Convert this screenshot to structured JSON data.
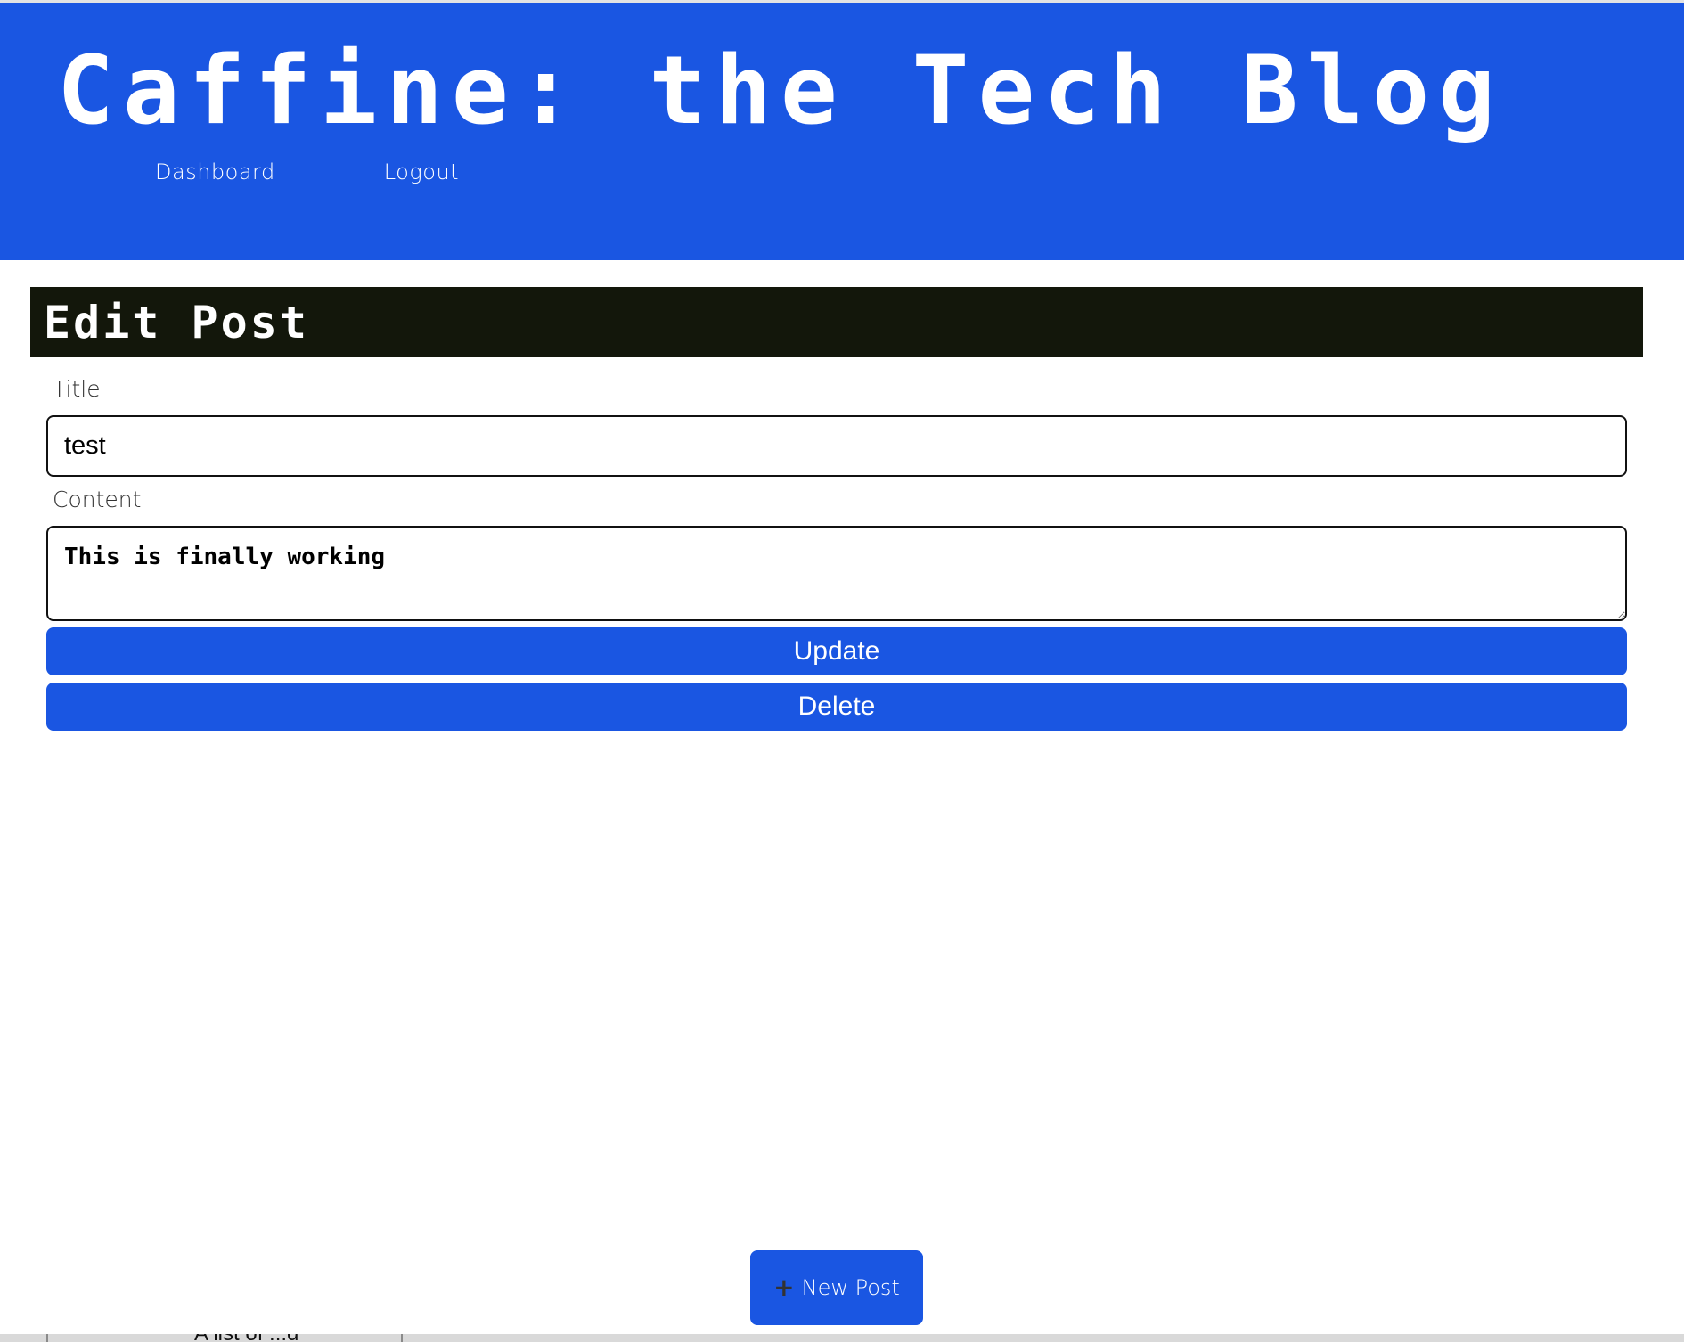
{
  "site": {
    "title": "Caffine:  the Tech Blog",
    "nav": {
      "dashboard": "Dashboard",
      "logout": "Logout"
    }
  },
  "edit_post": {
    "heading": "Edit Post",
    "title_label": "Title",
    "title_value": "test",
    "content_label": "Content",
    "content_value": "This is finally working",
    "update_label": "Update",
    "delete_label": "Delete"
  },
  "new_post": {
    "icon": "plus-icon",
    "label": "New Post"
  },
  "bottom_strip": {
    "partial_text": "A list of ...d"
  },
  "colors": {
    "header_blue": "#1a56e2",
    "card_header_dark": "#13170b",
    "button_blue": "#1a56e2",
    "text_white": "#ffffff"
  }
}
